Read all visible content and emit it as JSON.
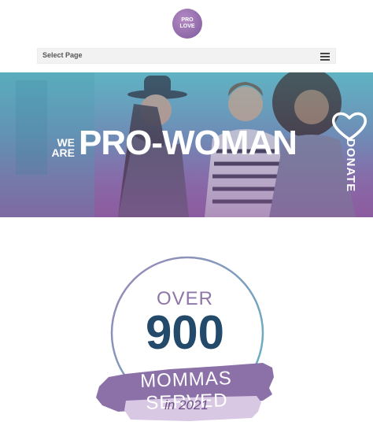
{
  "logo": {
    "line1": "PRO",
    "line2": "LOVE",
    "tagline": ""
  },
  "nav": {
    "select_label": "Select Page"
  },
  "hero": {
    "we": "WE",
    "are": "ARE",
    "title": "PRO-WOMAN",
    "donate": "DONATE"
  },
  "stats": {
    "over": "OVER",
    "number": "900",
    "label": "MOMMAS SERVED",
    "year": "in 2021"
  },
  "colors": {
    "navy": "#244a6b",
    "purple": "#8a6fab",
    "teal": "#5fb2c2"
  }
}
